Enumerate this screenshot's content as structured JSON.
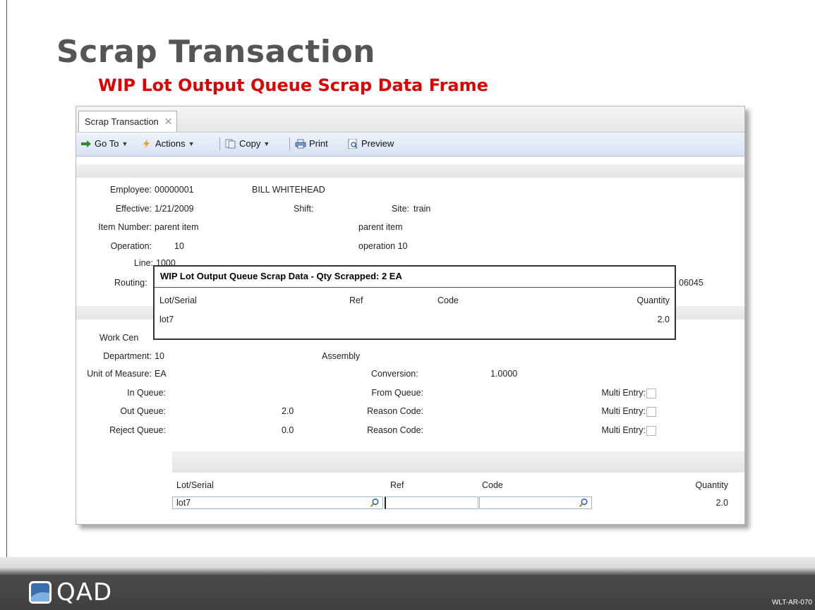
{
  "slide": {
    "title": "Scrap Transaction",
    "subtitle": "WIP Lot Output Queue Scrap Data Frame",
    "code": "WLT-AR-070",
    "logo_text": "QAD"
  },
  "tab": {
    "label": "Scrap Transaction",
    "close": "✕"
  },
  "toolbar": {
    "goto_label": "Go To",
    "actions_label": "Actions",
    "copy_label": "Copy",
    "print_label": "Print",
    "preview_label": "Preview"
  },
  "form": {
    "employee_label": "Employee:",
    "employee_value": "00000001",
    "employee_name": "BILL WHITEHEAD",
    "effective_label": "Effective:",
    "effective_value": "1/21/2009",
    "shift_label": "Shift:",
    "site_label": "Site:",
    "site_value": "train",
    "item_label": "Item Number:",
    "item_value": "parent item",
    "item_desc": "parent item",
    "operation_label": "Operation:",
    "operation_value": "10",
    "operation_desc": "operation 10",
    "line_label": "Line:",
    "line_value": "1000",
    "routing_label": "Routing:",
    "routing_tail": "06045",
    "workcenter_label": "Work Cen",
    "department_label": "Department:",
    "department_value": "10",
    "department_desc": "Assembly",
    "uom_label": "Unit of Measure:",
    "uom_value": "EA",
    "conversion_label": "Conversion:",
    "conversion_value": "1.0000",
    "in_queue_label": "In Queue:",
    "from_queue_label": "From Queue:",
    "out_queue_label": "Out Queue:",
    "out_queue_value": "2.0",
    "reject_queue_label": "Reject Queue:",
    "reject_queue_value": "0.0",
    "reason_code_label": "Reason Code:",
    "multi_entry_label": "Multi Entry:"
  },
  "popup": {
    "title": "WIP Lot Output Queue Scrap Data - Qty Scrapped: 2 EA",
    "columns": [
      "Lot/Serial",
      "Ref",
      "Code",
      "Quantity"
    ],
    "rows": [
      {
        "lot": "lot7",
        "ref": "",
        "code": "",
        "quantity": "2.0"
      }
    ]
  },
  "grid": {
    "columns": [
      "Lot/Serial",
      "Ref",
      "Code",
      "Quantity"
    ],
    "lot_value": "lot7",
    "ref_value": "",
    "code_value": "",
    "quantity_value": "2.0"
  },
  "colors": {
    "subtitle": "#e00000",
    "title": "#555555",
    "toolbar": "#d6e2f3"
  }
}
